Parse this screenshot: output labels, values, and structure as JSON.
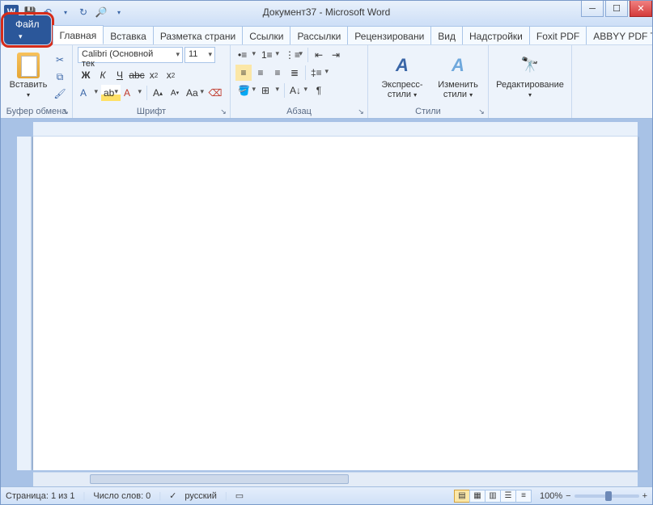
{
  "title": "Документ37 - Microsoft Word",
  "qat": {
    "save": "💾",
    "undo": "↶",
    "redo": "↷",
    "refresh": "↻",
    "find": "🔎"
  },
  "tabs": {
    "file": "Файл",
    "list": [
      "Главная",
      "Вставка",
      "Разметка страни",
      "Ссылки",
      "Рассылки",
      "Рецензировани",
      "Вид",
      "Надстройки",
      "Foxit PDF",
      "ABBYY PDF Trans"
    ]
  },
  "ribbon": {
    "clipboard": {
      "paste": "Вставить",
      "label": "Буфер обмена"
    },
    "font": {
      "name": "Calibri (Основной тек",
      "size": "11",
      "label": "Шрифт"
    },
    "paragraph": {
      "label": "Абзац"
    },
    "styles": {
      "quick": "Экспресс-стили",
      "change": "Изменить стили",
      "label": "Стили"
    },
    "editing": {
      "label": "Редактирование"
    }
  },
  "status": {
    "page": "Страница: 1 из 1",
    "words": "Число слов: 0",
    "lang": "русский",
    "zoom": "100%"
  }
}
